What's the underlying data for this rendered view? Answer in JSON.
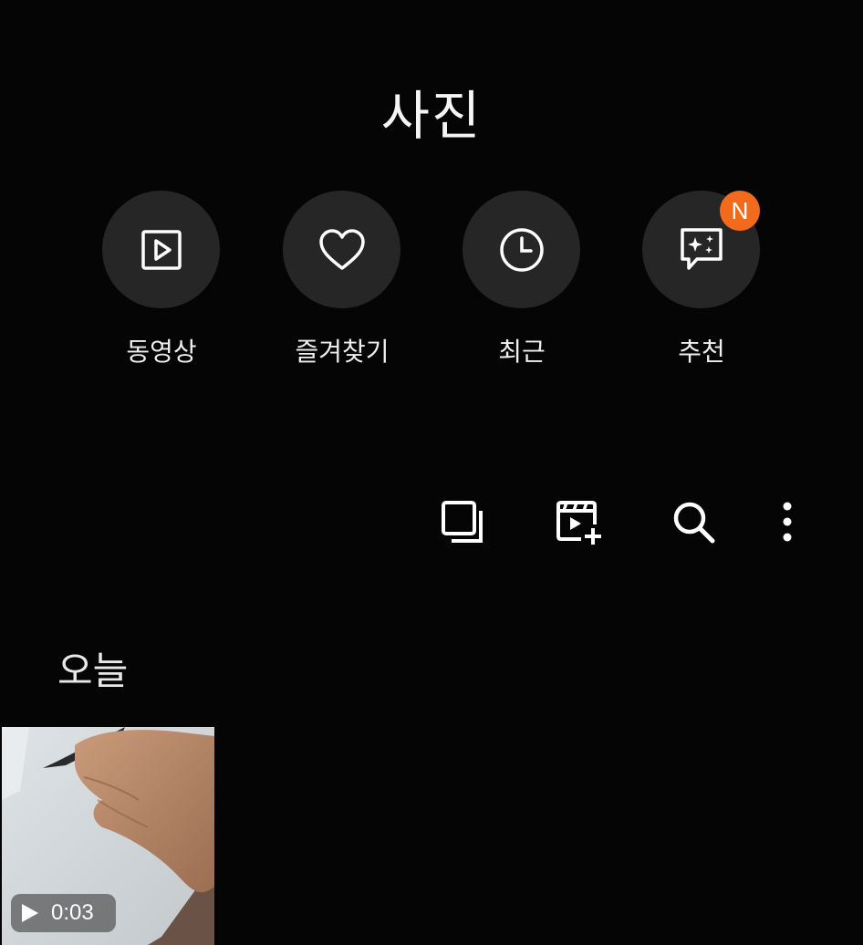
{
  "header": {
    "title": "사진"
  },
  "quick_access": [
    {
      "label": "동영상",
      "icon": "video-icon"
    },
    {
      "label": "즐겨찾기",
      "icon": "heart-icon"
    },
    {
      "label": "최근",
      "icon": "clock-icon"
    },
    {
      "label": "추천",
      "icon": "sparkle-chat-icon",
      "badge": "N"
    }
  ],
  "toolbar": {
    "icons": [
      "select-icon",
      "create-video-icon",
      "search-icon",
      "more-icon"
    ]
  },
  "section": {
    "title": "오늘"
  },
  "thumbnails": [
    {
      "duration": "0:03",
      "icon": "play-icon"
    }
  ],
  "colors": {
    "background": "#050505",
    "circle": "#262626",
    "badge": "#f26a1b"
  }
}
